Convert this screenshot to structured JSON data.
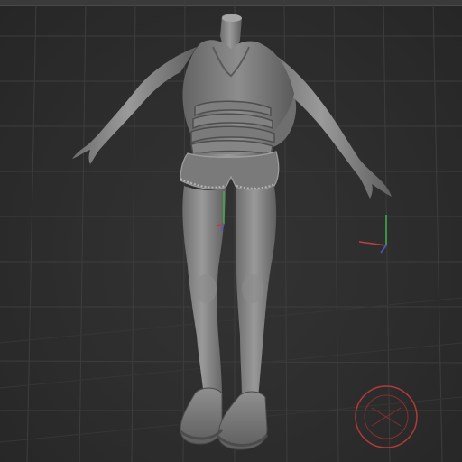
{
  "viewport": {
    "background": "#2b2b2b",
    "grid_color": "#3c3c3c",
    "model_color": "#8a8a8a",
    "model_shadow": "#5c5c5c",
    "gizmo_color": "#b03a3a"
  },
  "icons": {
    "rotate_gizmo": "rotate-gizmo-icon",
    "axis_x": "axis-x-icon",
    "axis_y": "axis-y-icon",
    "axis_z": "axis-z-icon"
  }
}
